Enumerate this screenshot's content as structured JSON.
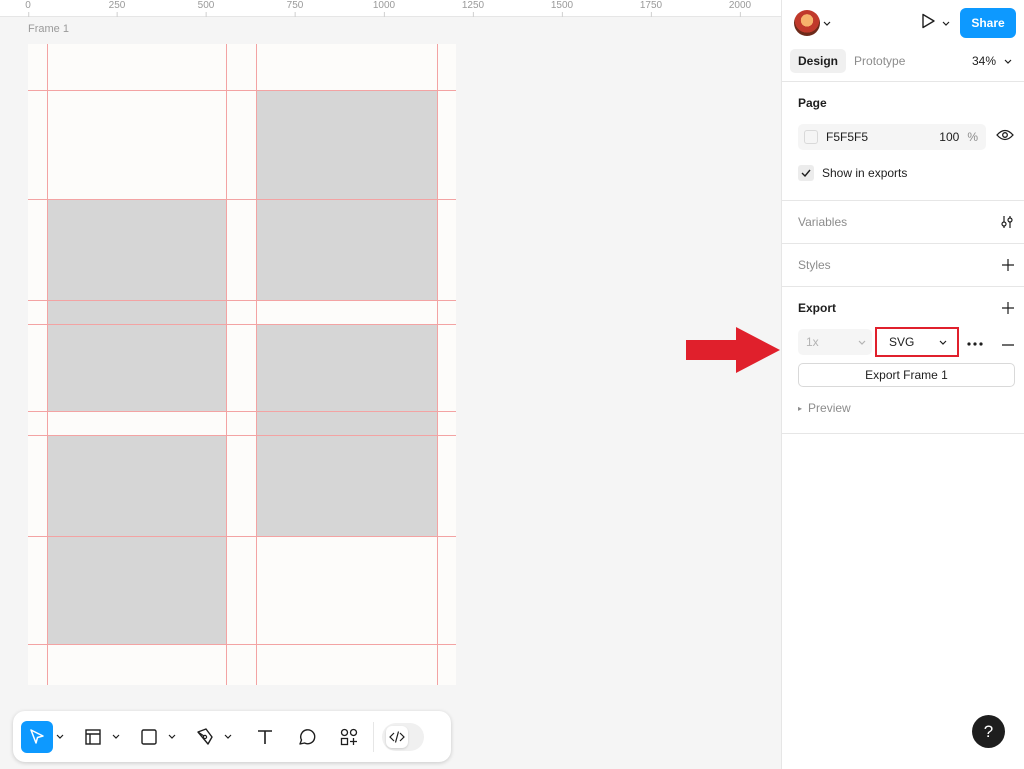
{
  "ruler": {
    "ticks": [
      "0",
      "250",
      "500",
      "750",
      "1000",
      "1250",
      "1500",
      "1750",
      "2000"
    ]
  },
  "canvas": {
    "frame_name": "Frame 1"
  },
  "toolbar": {
    "tools": [
      "move-icon",
      "frame-icon",
      "rectangle-icon",
      "pen-icon",
      "text-icon",
      "comment-icon",
      "actions-icon"
    ],
    "dev_mode_icon": "code-icon"
  },
  "header": {
    "share_label": "Share"
  },
  "tabs": {
    "design": "Design",
    "prototype": "Prototype",
    "zoom": "34%"
  },
  "page": {
    "title": "Page",
    "color_hex": "F5F5F5",
    "opacity": "100",
    "opacity_unit": "%",
    "show_in_exports": "Show in exports"
  },
  "variables": {
    "title": "Variables"
  },
  "styles": {
    "title": "Styles"
  },
  "export": {
    "title": "Export",
    "scale": "1x",
    "format": "SVG",
    "button_label": "Export Frame 1",
    "preview_label": "Preview"
  },
  "help": {
    "label": "?"
  },
  "colors": {
    "accent": "#0d99ff",
    "highlight": "#e0202c",
    "grid_line": "#f3a3a3",
    "placeholder_fill": "#d6d6d6"
  }
}
